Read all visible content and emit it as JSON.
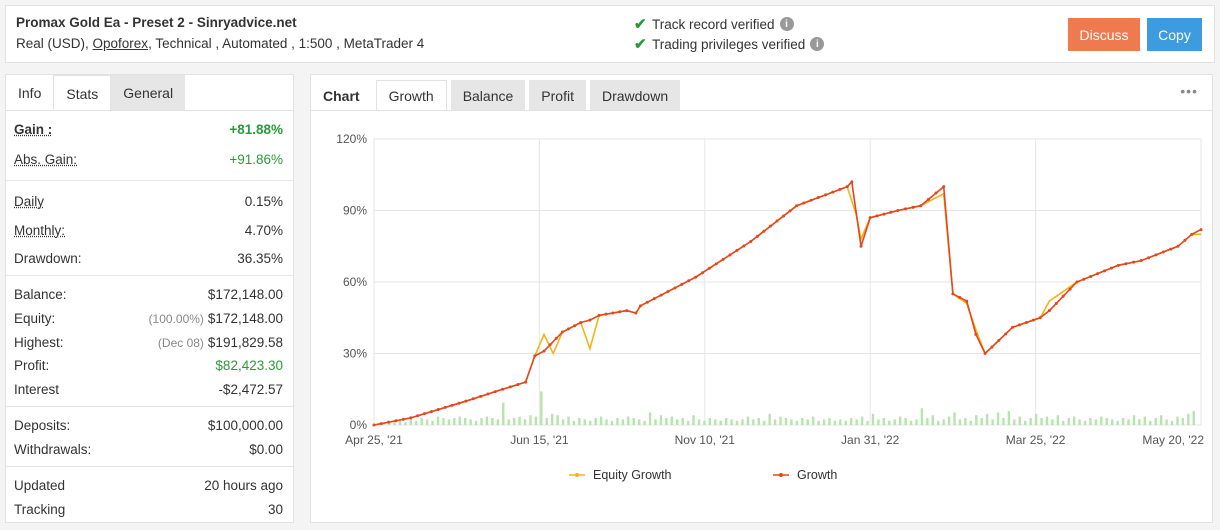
{
  "header": {
    "title": "Promax Gold Ea - Preset 2 - Sinryadvice.net",
    "sub_prefix": "Real (USD),",
    "broker": "Opoforex",
    "sub_suffix": ", Technical , Automated , 1:500 , MetaTrader 4",
    "verified_1": "Track record verified",
    "verified_2": "Trading privileges verified",
    "discuss_label": "Discuss",
    "copy_label": "Copy",
    "colors": {
      "discuss": "#ef7a4f",
      "copy": "#3e9be0",
      "check": "#2a9b3b"
    }
  },
  "left_tabs": [
    "Info",
    "Stats",
    "General"
  ],
  "stats": {
    "gain": {
      "label": "Gain :",
      "value": "+81.88%"
    },
    "abs_gain": {
      "label": "Abs. Gain:",
      "value": "+91.86%"
    },
    "daily": {
      "label": "Daily",
      "value": "0.15%"
    },
    "monthly": {
      "label": "Monthly:",
      "value": "4.70%"
    },
    "drawdown": {
      "label": "Drawdown:",
      "value": "36.35%"
    },
    "balance": {
      "label": "Balance:",
      "value": "$172,148.00"
    },
    "equity": {
      "label": "Equity:",
      "note": "(100.00%)",
      "value": "$172,148.00"
    },
    "highest": {
      "label": "Highest:",
      "note": "(Dec 08)",
      "value": "$191,829.58"
    },
    "profit": {
      "label": "Profit:",
      "value": "$82,423.30"
    },
    "interest": {
      "label": "Interest",
      "value": "-$2,472.57"
    },
    "deposits": {
      "label": "Deposits:",
      "value": "$100,000.00"
    },
    "withdrawals": {
      "label": "Withdrawals:",
      "value": "$0.00"
    },
    "updated": {
      "label": "Updated",
      "value": "20 hours ago"
    },
    "tracking": {
      "label": "Tracking",
      "value": "30"
    }
  },
  "chart_tabs": [
    "Chart",
    "Growth",
    "Balance",
    "Profit",
    "Drawdown"
  ],
  "chart_menu": "•••",
  "chart_data": {
    "type": "line",
    "y_ticks": [
      "0%",
      "30%",
      "60%",
      "90%",
      "120%"
    ],
    "ylim": [
      0,
      120
    ],
    "x_ticks": [
      "Apr 25, '21",
      "Jun 15, '21",
      "Nov 10, '21",
      "Jan 31, '22",
      "Mar 25, '22",
      "May 20, '22"
    ],
    "grid": true,
    "legend_position": "bottom",
    "series": [
      {
        "name": "Equity Growth",
        "color": "#f5b21a",
        "points": [
          [
            0,
            0
          ],
          [
            8,
            3
          ],
          [
            20,
            10
          ],
          [
            28,
            15
          ],
          [
            33,
            18
          ],
          [
            35,
            29
          ],
          [
            37,
            38
          ],
          [
            39,
            30
          ],
          [
            41,
            39
          ],
          [
            45,
            43
          ],
          [
            47,
            32
          ],
          [
            49,
            46
          ],
          [
            55,
            48
          ],
          [
            57,
            47
          ],
          [
            58,
            50
          ],
          [
            70,
            62
          ],
          [
            82,
            77
          ],
          [
            92,
            92
          ],
          [
            103,
            100
          ],
          [
            105,
            88
          ],
          [
            106,
            78
          ],
          [
            108,
            87
          ],
          [
            114,
            90
          ],
          [
            119,
            92
          ],
          [
            124,
            97
          ],
          [
            126,
            55
          ],
          [
            129,
            51
          ],
          [
            131,
            40
          ],
          [
            133,
            30
          ],
          [
            139,
            41
          ],
          [
            145,
            45
          ],
          [
            147,
            52
          ],
          [
            153,
            60
          ],
          [
            162,
            67
          ],
          [
            167,
            69
          ],
          [
            175,
            75
          ],
          [
            178,
            80
          ],
          [
            180,
            80
          ]
        ]
      },
      {
        "name": "Growth",
        "color": "#e4461d",
        "points": [
          [
            0,
            0
          ],
          [
            8,
            3
          ],
          [
            20,
            10
          ],
          [
            28,
            15
          ],
          [
            33,
            18
          ],
          [
            35,
            29
          ],
          [
            37,
            31
          ],
          [
            41,
            39
          ],
          [
            45,
            43
          ],
          [
            47,
            44
          ],
          [
            49,
            46
          ],
          [
            55,
            48
          ],
          [
            57,
            47
          ],
          [
            58,
            50
          ],
          [
            70,
            62
          ],
          [
            82,
            77
          ],
          [
            92,
            92
          ],
          [
            103,
            100
          ],
          [
            104,
            102
          ],
          [
            106,
            75
          ],
          [
            108,
            87
          ],
          [
            114,
            90
          ],
          [
            119,
            92
          ],
          [
            124,
            100
          ],
          [
            126,
            55
          ],
          [
            129,
            52
          ],
          [
            131,
            38
          ],
          [
            133,
            30
          ],
          [
            139,
            41
          ],
          [
            145,
            45
          ],
          [
            147,
            48
          ],
          [
            153,
            60
          ],
          [
            162,
            67
          ],
          [
            167,
            69
          ],
          [
            175,
            75
          ],
          [
            178,
            80
          ],
          [
            180,
            82
          ]
        ]
      }
    ],
    "volume_bars": [
      1,
      1,
      2,
      3,
      3,
      2,
      4,
      3,
      5,
      4,
      3,
      6,
      5,
      4,
      5,
      6,
      5,
      4,
      3,
      5,
      6,
      5,
      4,
      16,
      4,
      5,
      6,
      4,
      7,
      6,
      24,
      5,
      8,
      7,
      4,
      6,
      3,
      5,
      4,
      3,
      5,
      6,
      4,
      3,
      5,
      4,
      6,
      5,
      4,
      3,
      9,
      4,
      7,
      5,
      6,
      4,
      5,
      3,
      7,
      4,
      3,
      5,
      4,
      3,
      5,
      4,
      3,
      4,
      6,
      4,
      5,
      3,
      8,
      4,
      6,
      5,
      4,
      3,
      5,
      4,
      6,
      3,
      4,
      5,
      3,
      4,
      3,
      5,
      4,
      6,
      3,
      8,
      4,
      5,
      3,
      4,
      6,
      5,
      3,
      4,
      12,
      5,
      7,
      3,
      4,
      6,
      9,
      4,
      5,
      3,
      7,
      5,
      8,
      4,
      9,
      5,
      10,
      4,
      6,
      3,
      5,
      8,
      5,
      6,
      4,
      7,
      3,
      5,
      6,
      4,
      3,
      5,
      4,
      6,
      5,
      4,
      3,
      5,
      4,
      7,
      4,
      6,
      3,
      5,
      7,
      4,
      3,
      6,
      5,
      8,
      10
    ]
  }
}
